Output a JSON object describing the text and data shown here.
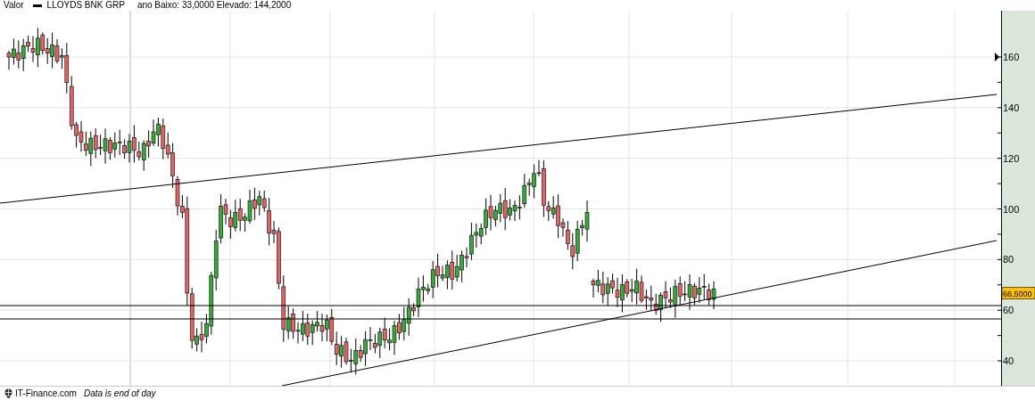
{
  "header": {
    "label": "Valor",
    "series": "LLOYDS BNK GRP",
    "range": "ano Baixo: 33,0000 Elevado: 144,2000"
  },
  "axis": {
    "ticks": [
      "160",
      "140",
      "120",
      "100",
      "80",
      "60",
      "40"
    ],
    "last_price": "66,5000"
  },
  "footer": {
    "source": "IT-Finance.com",
    "note": "Data is end of day"
  }
}
